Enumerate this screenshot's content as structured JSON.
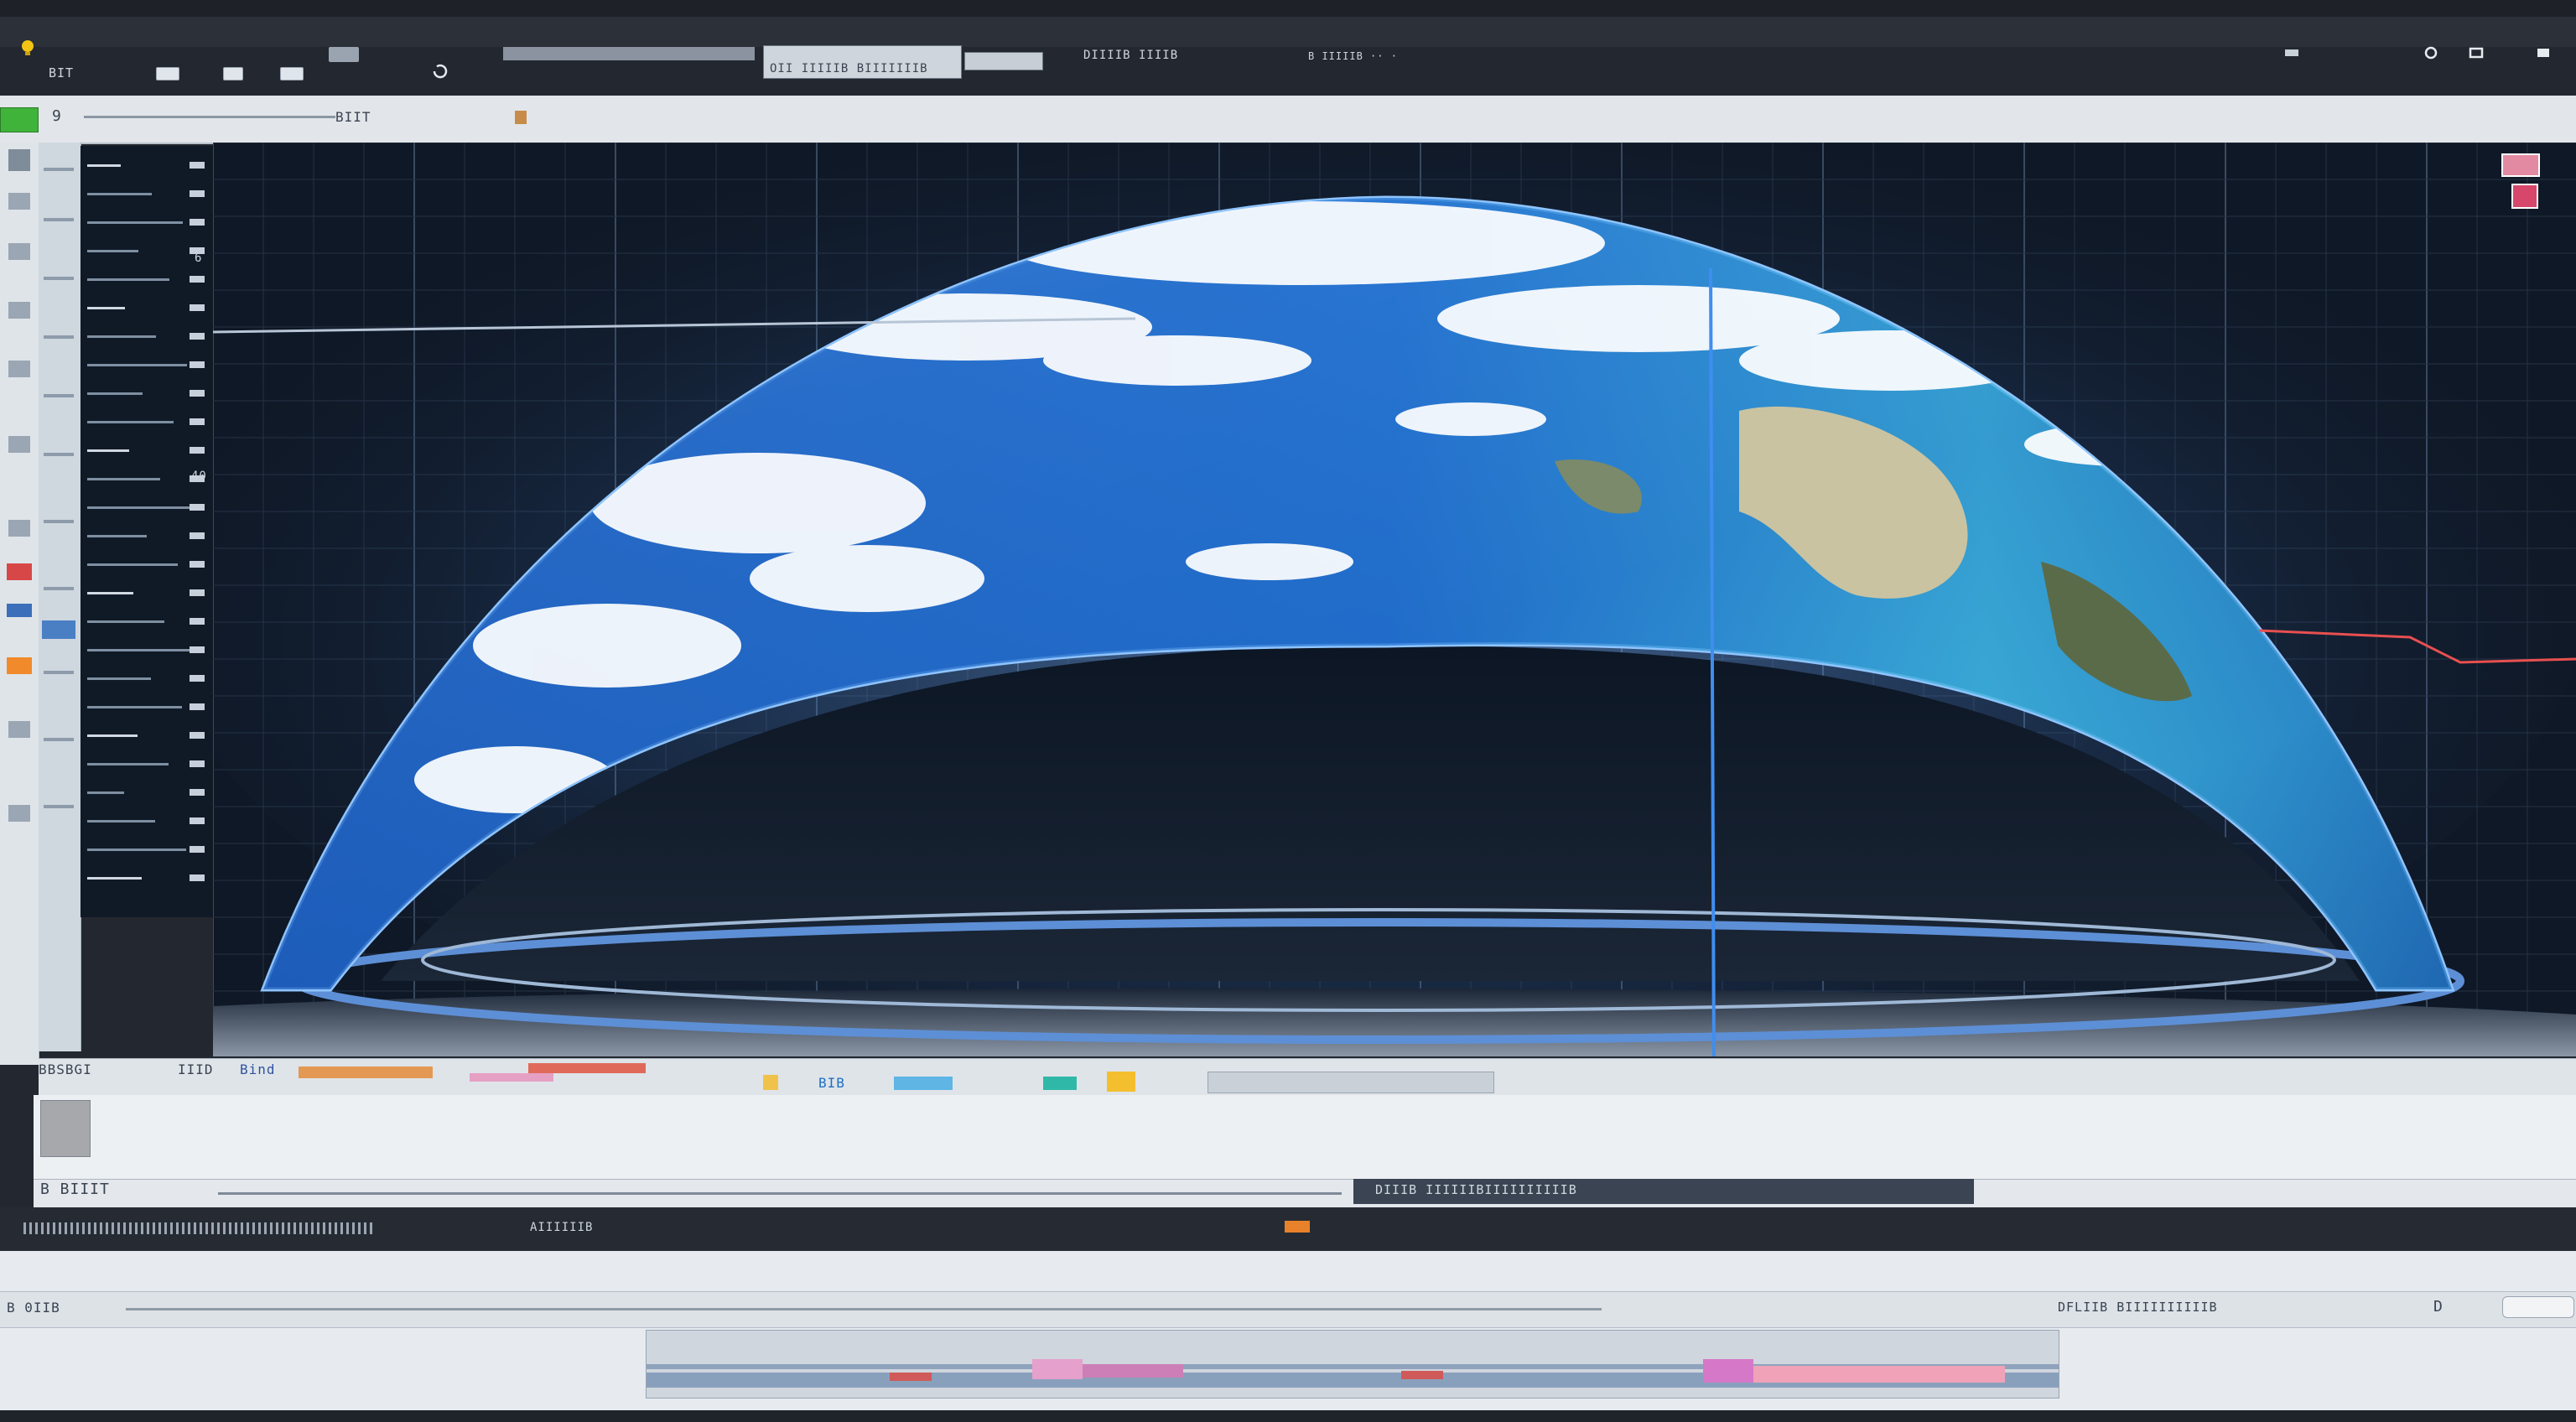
{
  "window": {
    "title_left": "BIT",
    "menu_center": "OII IIIIIB BIIIIIIIB",
    "menu_right": "DIIIIB IIIIB",
    "icons": [
      "bulb-icon",
      "minimize-icon",
      "maximize-icon",
      "close-icon"
    ]
  },
  "toolbar": {
    "path_text": "BIIT",
    "page_indicator": "9"
  },
  "left_panel": {
    "badges": [
      "6",
      "40"
    ]
  },
  "viewport": {
    "globe_label": "Earth dome"
  },
  "status_strip": {
    "label_left": "BBSBGI",
    "label_mid": "IIID",
    "label_tag": "Bind",
    "label_right": "BIB"
  },
  "timeline": {
    "label_left": "B BIIIT",
    "label_right": "DIIIB IIIIIIBIIIIIIIIIIB",
    "track_label": "AIIIIIIB"
  },
  "footer": {
    "label_left": "B 0IIB",
    "label_right": "DFLIIB BIIIIIIIIIIB",
    "page": "D"
  },
  "colors": {
    "accent": "#2a6fd6",
    "dark_bar": "#2a2f38",
    "panel": "#e6eaee",
    "grid_bg": "#0f1826"
  }
}
